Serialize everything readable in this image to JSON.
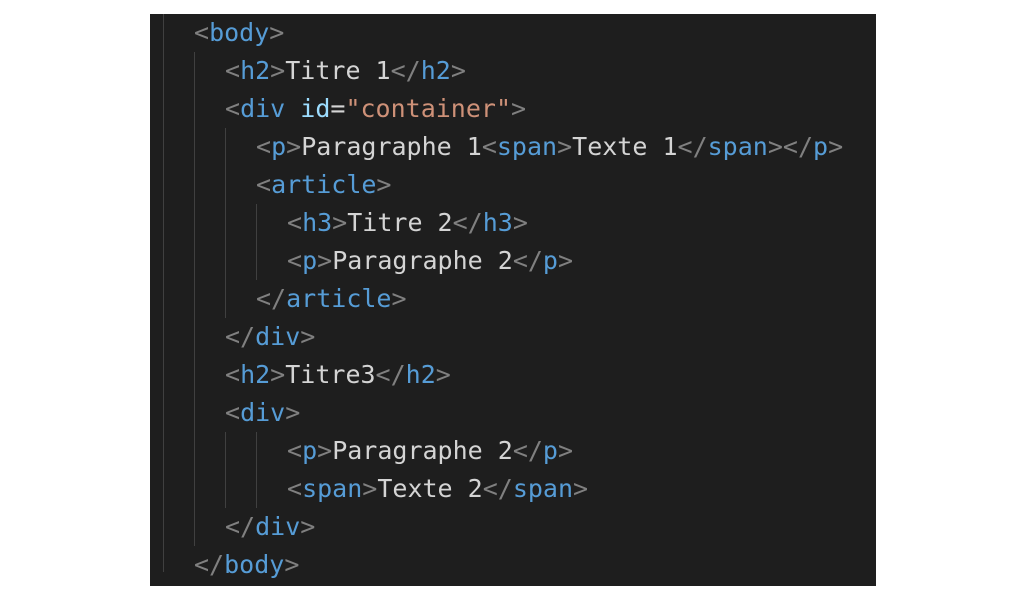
{
  "editor": {
    "lines": [
      [
        [
          "punct",
          "<"
        ],
        [
          "tag",
          "body"
        ],
        [
          "punct",
          ">"
        ]
      ],
      [
        [
          "punct",
          "<"
        ],
        [
          "tag",
          "h2"
        ],
        [
          "punct",
          ">"
        ],
        [
          "text",
          "Titre 1"
        ],
        [
          "punct",
          "</"
        ],
        [
          "tag",
          "h2"
        ],
        [
          "punct",
          ">"
        ]
      ],
      [
        [
          "punct",
          "<"
        ],
        [
          "tag",
          "div"
        ],
        [
          "text",
          " "
        ],
        [
          "attr",
          "id"
        ],
        [
          "eq",
          "="
        ],
        [
          "str",
          "\"container\""
        ],
        [
          "punct",
          ">"
        ]
      ],
      [
        [
          "punct",
          "<"
        ],
        [
          "tag",
          "p"
        ],
        [
          "punct",
          ">"
        ],
        [
          "text",
          "Paragraphe 1"
        ],
        [
          "punct",
          "<"
        ],
        [
          "tag",
          "span"
        ],
        [
          "punct",
          ">"
        ],
        [
          "text",
          "Texte 1"
        ],
        [
          "punct",
          "</"
        ],
        [
          "tag",
          "span"
        ],
        [
          "punct",
          "></"
        ],
        [
          "tag",
          "p"
        ],
        [
          "punct",
          ">"
        ]
      ],
      [
        [
          "punct",
          "<"
        ],
        [
          "tag",
          "article"
        ],
        [
          "punct",
          ">"
        ]
      ],
      [
        [
          "punct",
          "<"
        ],
        [
          "tag",
          "h3"
        ],
        [
          "punct",
          ">"
        ],
        [
          "text",
          "Titre 2"
        ],
        [
          "punct",
          "</"
        ],
        [
          "tag",
          "h3"
        ],
        [
          "punct",
          ">"
        ]
      ],
      [
        [
          "punct",
          "<"
        ],
        [
          "tag",
          "p"
        ],
        [
          "punct",
          ">"
        ],
        [
          "text",
          "Paragraphe 2"
        ],
        [
          "punct",
          "</"
        ],
        [
          "tag",
          "p"
        ],
        [
          "punct",
          ">"
        ]
      ],
      [
        [
          "punct",
          "</"
        ],
        [
          "tag",
          "article"
        ],
        [
          "punct",
          ">"
        ]
      ],
      [
        [
          "punct",
          "</"
        ],
        [
          "tag",
          "div"
        ],
        [
          "punct",
          ">"
        ]
      ],
      [
        [
          "punct",
          "<"
        ],
        [
          "tag",
          "h2"
        ],
        [
          "punct",
          ">"
        ],
        [
          "text",
          "Titre3"
        ],
        [
          "punct",
          "</"
        ],
        [
          "tag",
          "h2"
        ],
        [
          "punct",
          ">"
        ]
      ],
      [
        [
          "punct",
          "<"
        ],
        [
          "tag",
          "div"
        ],
        [
          "punct",
          ">"
        ]
      ],
      [
        [
          "punct",
          "<"
        ],
        [
          "tag",
          "p"
        ],
        [
          "punct",
          ">"
        ],
        [
          "text",
          "Paragraphe 2"
        ],
        [
          "punct",
          "</"
        ],
        [
          "tag",
          "p"
        ],
        [
          "punct",
          ">"
        ]
      ],
      [
        [
          "punct",
          "<"
        ],
        [
          "tag",
          "span"
        ],
        [
          "punct",
          ">"
        ],
        [
          "text",
          "Texte 2"
        ],
        [
          "punct",
          "</"
        ],
        [
          "tag",
          "span"
        ],
        [
          "punct",
          ">"
        ]
      ],
      [
        [
          "punct",
          "</"
        ],
        [
          "tag",
          "div"
        ],
        [
          "punct",
          ">"
        ]
      ],
      [
        [
          "punct",
          "</"
        ],
        [
          "tag",
          "body"
        ],
        [
          "punct",
          ">"
        ]
      ]
    ]
  },
  "colors": {
    "background": "#1e1e1e",
    "punctuation": "#808080",
    "tag": "#569cd6",
    "text": "#d4d4d4",
    "attribute": "#9cdcfe",
    "string": "#ce9178"
  }
}
